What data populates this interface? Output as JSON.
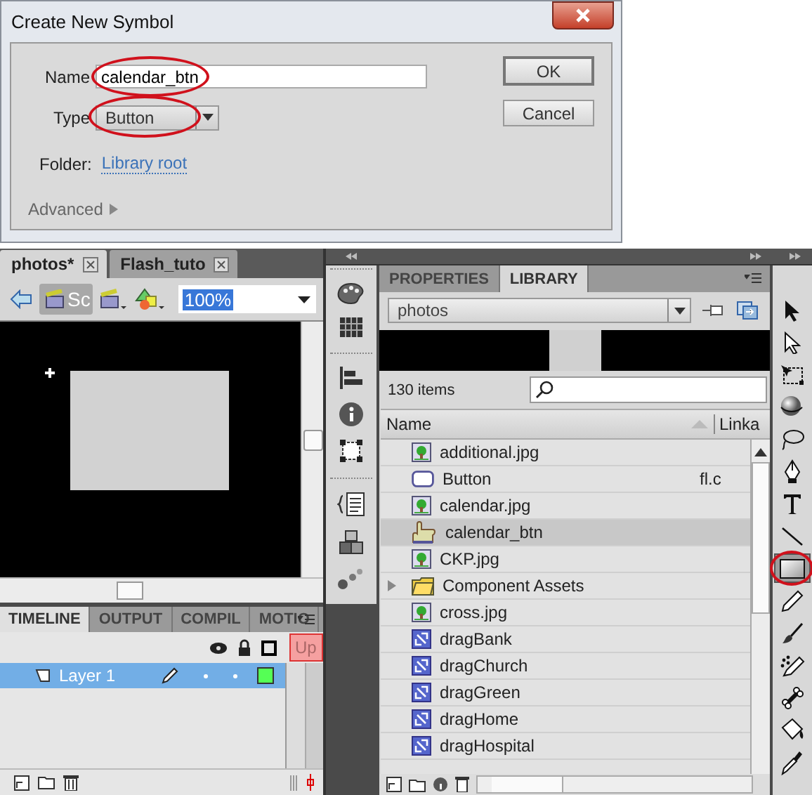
{
  "dialog": {
    "title": "Create New Symbol",
    "name_label": "Name",
    "name_value": "calendar_btn",
    "name_circled": true,
    "type_label": "Type",
    "type_value": "Button",
    "type_circled": true,
    "folder_label": "Folder:",
    "folder_link": "Library root",
    "advanced": "Advanced",
    "buttons": [
      "OK",
      "Cancel"
    ]
  },
  "document_tabs": [
    {
      "label": "photos*",
      "selected": true
    },
    {
      "label": "Flash_tuto",
      "selected": false
    }
  ],
  "edit_bar": {
    "scene": "Sc",
    "zoom": "100%"
  },
  "timeline": {
    "tabs": [
      {
        "label": "TIMELINE",
        "selected": true
      },
      {
        "label": "OUTPUT",
        "selected": false
      },
      {
        "label": "COMPIL",
        "selected": false
      },
      {
        "label": "MOTIO",
        "selected": false
      }
    ],
    "frame_label": "Up",
    "layers": [
      {
        "name": "Layer 1",
        "selected": true
      }
    ]
  },
  "library": {
    "tabs": [
      {
        "label": "PROPERTIES",
        "selected": false
      },
      {
        "label": "LIBRARY",
        "selected": true
      }
    ],
    "document": "photos",
    "count": "130 items",
    "columns": [
      "Name",
      "Linka"
    ],
    "items": [
      {
        "name": "additional.jpg",
        "kind": "bitmap",
        "selected": false
      },
      {
        "name": "Button",
        "kind": "component",
        "selected": false,
        "linkage": "fl.c"
      },
      {
        "name": "calendar.jpg",
        "kind": "bitmap",
        "selected": false
      },
      {
        "name": "calendar_btn",
        "kind": "button",
        "selected": true
      },
      {
        "name": "CKP.jpg",
        "kind": "bitmap",
        "selected": false
      },
      {
        "name": "Component Assets",
        "kind": "folder",
        "selected": false,
        "expanded": false
      },
      {
        "name": "cross.jpg",
        "kind": "bitmap",
        "selected": false
      },
      {
        "name": "dragBank",
        "kind": "movieclip",
        "selected": false
      },
      {
        "name": "dragChurch",
        "kind": "movieclip",
        "selected": false
      },
      {
        "name": "dragGreen",
        "kind": "movieclip",
        "selected": false
      },
      {
        "name": "dragHome",
        "kind": "movieclip",
        "selected": false
      },
      {
        "name": "dragHospital",
        "kind": "movieclip",
        "selected": false
      }
    ]
  },
  "tools": [
    {
      "kind": "selection",
      "selected": false,
      "circled": false
    },
    {
      "kind": "subselection",
      "selected": false,
      "circled": false
    },
    {
      "kind": "transform",
      "selected": false,
      "circled": false
    },
    {
      "kind": "rotate3d",
      "selected": false,
      "circled": false
    },
    {
      "kind": "lasso",
      "selected": false,
      "circled": false
    },
    {
      "kind": "pen",
      "selected": false,
      "circled": false
    },
    {
      "kind": "text",
      "selected": false,
      "circled": false
    },
    {
      "kind": "line",
      "selected": false,
      "circled": false
    },
    {
      "kind": "rectangle",
      "selected": true,
      "circled": true
    },
    {
      "kind": "pencil",
      "selected": false,
      "circled": false
    },
    {
      "kind": "brush",
      "selected": false,
      "circled": false
    },
    {
      "kind": "deco",
      "selected": false,
      "circled": false
    },
    {
      "kind": "bone",
      "selected": false,
      "circled": false
    },
    {
      "kind": "bucket",
      "selected": false,
      "circled": false
    },
    {
      "kind": "eyedropper",
      "selected": false,
      "circled": false
    }
  ]
}
